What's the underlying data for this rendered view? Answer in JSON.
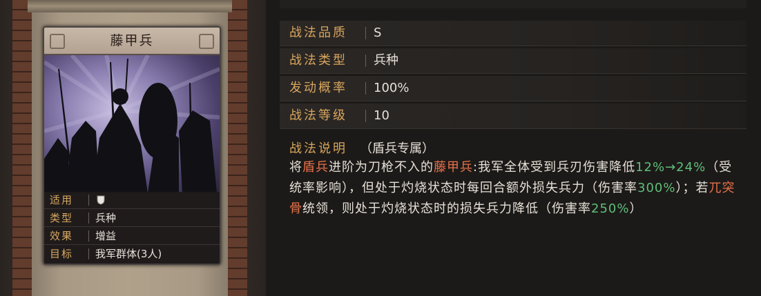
{
  "card": {
    "title": "藤甲兵",
    "info": [
      {
        "key": "适用",
        "value": "",
        "icon": "shield-icon"
      },
      {
        "key": "类型",
        "value": "兵种"
      },
      {
        "key": "效果",
        "value": "增益"
      },
      {
        "key": "目标",
        "value": "我军群体(3人)"
      }
    ]
  },
  "details": {
    "rows": [
      {
        "key": "战法品质",
        "value": "S"
      },
      {
        "key": "战法类型",
        "value": "兵种"
      },
      {
        "key": "发动概率",
        "value": "100%"
      },
      {
        "key": "战法等级",
        "value": "10"
      }
    ],
    "description": {
      "label": "战法说明",
      "note": "（盾兵专属）",
      "segments": [
        {
          "text": "将",
          "style": "normal"
        },
        {
          "text": "盾兵",
          "style": "orange"
        },
        {
          "text": "进阶为刀枪不入的",
          "style": "normal"
        },
        {
          "text": "藤甲兵",
          "style": "orange"
        },
        {
          "text": ":我军全体受到兵刃伤害降低",
          "style": "normal"
        },
        {
          "text": "12%→24%",
          "style": "green"
        },
        {
          "text": "（受统率影响），但处于灼烧状态时每回合额外损失兵力（伤害率",
          "style": "normal"
        },
        {
          "text": "300%",
          "style": "green"
        },
        {
          "text": "）；若",
          "style": "normal"
        },
        {
          "text": "兀突骨",
          "style": "orange"
        },
        {
          "text": "统领，则处于灼烧状态时的损失兵力降低（伤害率",
          "style": "normal"
        },
        {
          "text": "250%",
          "style": "green"
        },
        {
          "text": "）",
          "style": "normal"
        }
      ]
    }
  },
  "colors": {
    "label_gold": "#d9a65d",
    "highlight_orange": "#e8714a",
    "highlight_green": "#5fbf7a"
  }
}
